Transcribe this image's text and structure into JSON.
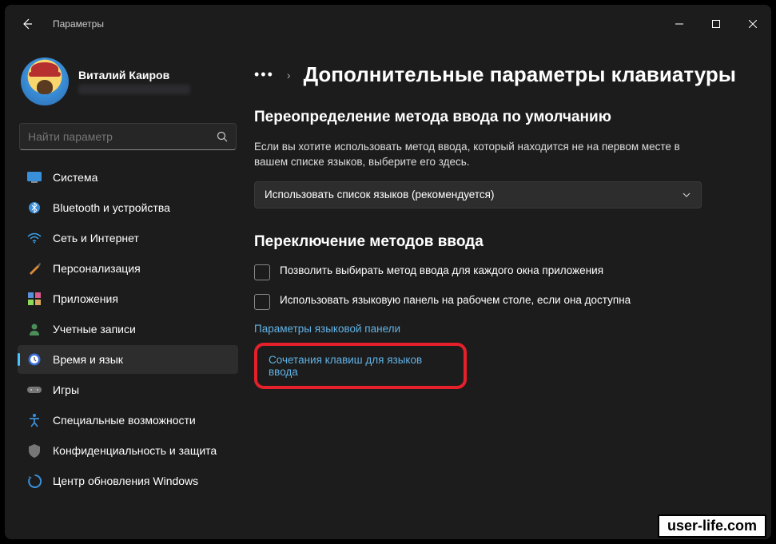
{
  "titlebar": {
    "title": "Параметры"
  },
  "user": {
    "name": "Виталий Каиров"
  },
  "search": {
    "placeholder": "Найти параметр"
  },
  "nav": {
    "system": "Система",
    "bluetooth": "Bluetooth и устройства",
    "network": "Сеть и Интернет",
    "personalization": "Персонализация",
    "apps": "Приложения",
    "accounts": "Учетные записи",
    "time_language": "Время и язык",
    "gaming": "Игры",
    "accessibility": "Специальные возможности",
    "privacy": "Конфиденциальность и защита",
    "update": "Центр обновления Windows"
  },
  "page": {
    "title": "Дополнительные параметры клавиатуры",
    "section1_heading": "Переопределение метода ввода по умолчанию",
    "section1_desc": "Если вы хотите использовать метод ввода, который находится не на первом месте в вашем списке языков, выберите его здесь.",
    "dropdown_value": "Использовать список языков (рекомендуется)",
    "section2_heading": "Переключение методов ввода",
    "checkbox1_label": "Позволить выбирать метод ввода для каждого окна приложения",
    "checkbox2_label": "Использовать языковую панель на рабочем столе, если она доступна",
    "link1": "Параметры языковой панели",
    "link2": "Сочетания клавиш для языков ввода"
  },
  "watermark": "user-life.com"
}
